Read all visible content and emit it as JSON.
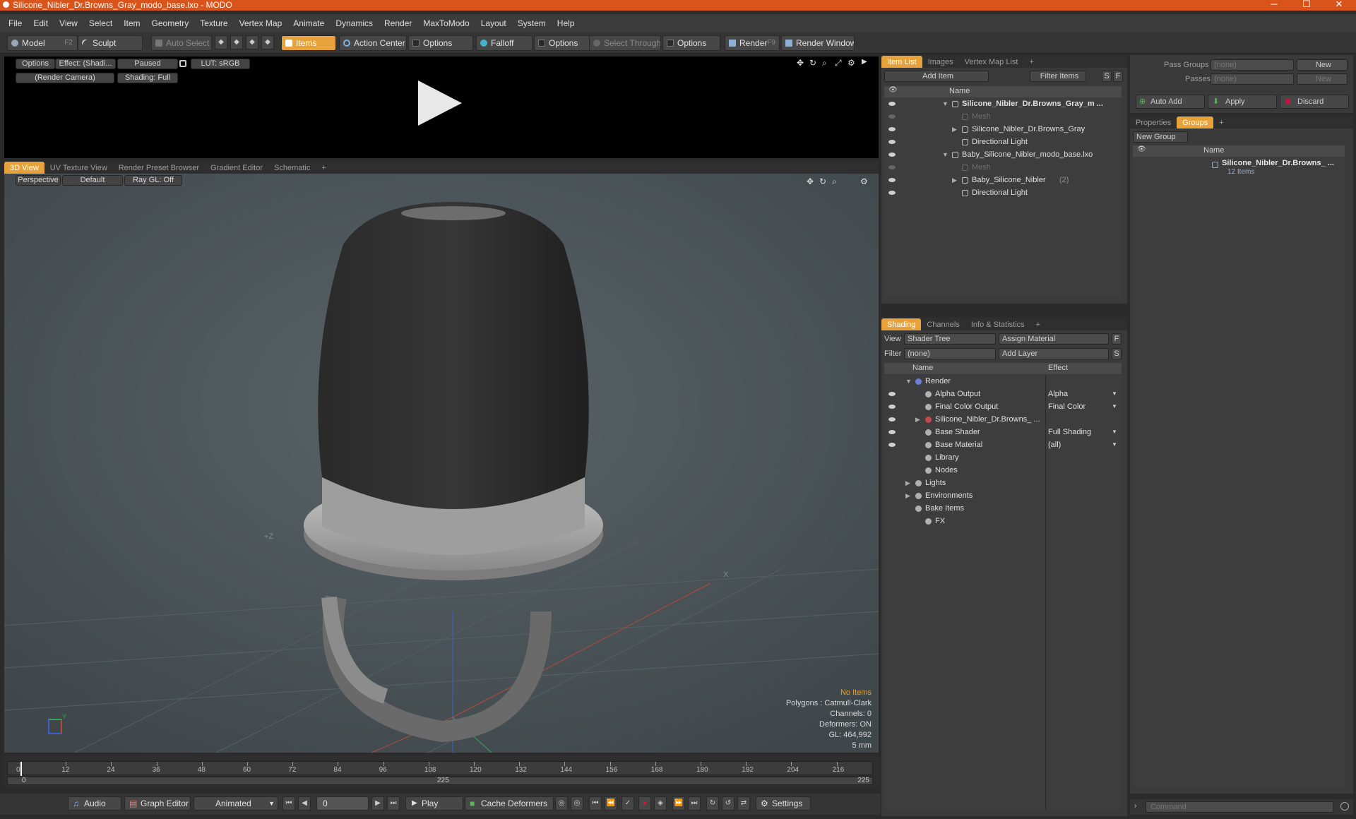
{
  "window": {
    "title": "Silicone_Nibler_Dr.Browns_Gray_modo_base.lxo - MODO",
    "minimize": "─",
    "maximize": "☐",
    "close": "✕"
  },
  "menu": [
    "File",
    "Edit",
    "View",
    "Select",
    "Item",
    "Geometry",
    "Texture",
    "Vertex Map",
    "Animate",
    "Dynamics",
    "Render",
    "MaxToModo",
    "Layout",
    "System",
    "Help"
  ],
  "toolbar": {
    "model": "Model",
    "model_key": "F2",
    "sculpt": "Sculpt",
    "auto_select": "Auto Select",
    "items": "Items",
    "action_center": "Action Center",
    "options1": "Options",
    "falloff": "Falloff",
    "options2": "Options",
    "select_through": "Select Through",
    "options3": "Options",
    "render": "Render",
    "render_key": "F9",
    "render_window": "Render Window"
  },
  "preview": {
    "options": "Options",
    "effect": "Effect: (Shadi...",
    "paused": "Paused",
    "lut": "LUT: sRGB",
    "camera": "(Render Camera)",
    "shading": "Shading: Full"
  },
  "viewport": {
    "tabs": [
      "3D View",
      "UV Texture View",
      "Render Preset Browser",
      "Gradient Editor",
      "Schematic"
    ],
    "add": "+",
    "perspective": "Perspective",
    "default": "Default",
    "raygl": "Ray GL: Off",
    "status": {
      "no_items": "No Items",
      "polygons": "Polygons : Catmull-Clark",
      "channels": "Channels: 0",
      "deformers": "Deformers: ON",
      "gl": "GL: 464,992",
      "scale": "5 mm"
    },
    "axis_label_z": "+Z",
    "axis_label_x": "X",
    "axis_label_y": "Y"
  },
  "timeline": {
    "ticks": [
      "0",
      "12",
      "24",
      "36",
      "48",
      "60",
      "72",
      "84",
      "96",
      "108",
      "120",
      "132",
      "144",
      "156",
      "168",
      "180",
      "192",
      "204",
      "216"
    ],
    "start": "0",
    "mid": "225",
    "end": "225"
  },
  "bottombar": {
    "audio": "Audio",
    "graph_editor": "Graph Editor",
    "animated": "Animated",
    "frame": "0",
    "play": "Play",
    "cache_deformers": "Cache Deformers",
    "settings": "Settings"
  },
  "itemlist": {
    "tabs": [
      "Item List",
      "Images",
      "Vertex Map List"
    ],
    "add_item": "Add Item",
    "filter_items": "Filter Items",
    "s": "S",
    "f": "F",
    "name_header": "Name",
    "rows": [
      {
        "label": "Silicone_Nibler_Dr.Browns_Gray_m ...",
        "indent": 0,
        "bold": true,
        "arrow": "▼"
      },
      {
        "label": "Mesh",
        "indent": 1,
        "dim": true,
        "arrow": ""
      },
      {
        "label": "Silicone_Nibler_Dr.Browns_Gray",
        "indent": 1,
        "arrow": "▶"
      },
      {
        "label": "Directional Light",
        "indent": 1,
        "arrow": ""
      },
      {
        "label": "Baby_Silicone_Nibler_modo_base.lxo",
        "indent": 0,
        "arrow": "▼"
      },
      {
        "label": "Mesh",
        "indent": 1,
        "dim": true,
        "arrow": ""
      },
      {
        "label": "Baby_Silicone_Nibler",
        "suffix": "(2)",
        "indent": 1,
        "arrow": "▶"
      },
      {
        "label": "Directional Light",
        "indent": 1,
        "arrow": ""
      }
    ]
  },
  "shading": {
    "tabs": [
      "Shading",
      "Channels",
      "Info & Statistics"
    ],
    "view_label": "View",
    "view_value": "Shader Tree",
    "assign_material": "Assign Material",
    "f": "F",
    "filter_label": "Filter",
    "filter_value": "(none)",
    "add_layer": "Add Layer",
    "s": "S",
    "col_name": "Name",
    "col_effect": "Effect",
    "rows": [
      {
        "label": "Render",
        "effect": "",
        "indent": 0,
        "arrow": "▼",
        "eye": false
      },
      {
        "label": "Alpha Output",
        "effect": "Alpha",
        "indent": 1,
        "eye": true
      },
      {
        "label": "Final Color Output",
        "effect": "Final Color",
        "indent": 1,
        "eye": true
      },
      {
        "label": "Silicone_Nibler_Dr.Browns_ ...",
        "effect": "",
        "indent": 1,
        "arrow": "▶",
        "eye": true
      },
      {
        "label": "Base Shader",
        "effect": "Full Shading",
        "indent": 1,
        "eye": true
      },
      {
        "label": "Base Material",
        "effect": "(all)",
        "indent": 1,
        "eye": true
      },
      {
        "label": "Library",
        "effect": "",
        "indent": 1,
        "eye": false
      },
      {
        "label": "Nodes",
        "effect": "",
        "indent": 1,
        "eye": false
      },
      {
        "label": "Lights",
        "effect": "",
        "indent": 0,
        "arrow": "▶",
        "eye": false
      },
      {
        "label": "Environments",
        "effect": "",
        "indent": 0,
        "arrow": "▶",
        "eye": false
      },
      {
        "label": "Bake Items",
        "effect": "",
        "indent": 0,
        "eye": false
      },
      {
        "label": "FX",
        "effect": "",
        "indent": 1,
        "eye": false
      }
    ]
  },
  "passes": {
    "pass_groups": "Pass Groups",
    "passes": "Passes",
    "none1": "(none)",
    "none2": "(none)",
    "new1": "New",
    "new2": "New",
    "auto_add": "Auto Add",
    "apply": "Apply",
    "discard": "Discard"
  },
  "groups": {
    "tabs": [
      "Properties",
      "Groups"
    ],
    "new_group": "New Group",
    "name_header": "Name",
    "group_name": "Silicone_Nibler_Dr.Browns_ ...",
    "group_count": "12 Items"
  },
  "command": {
    "placeholder": "Command"
  }
}
